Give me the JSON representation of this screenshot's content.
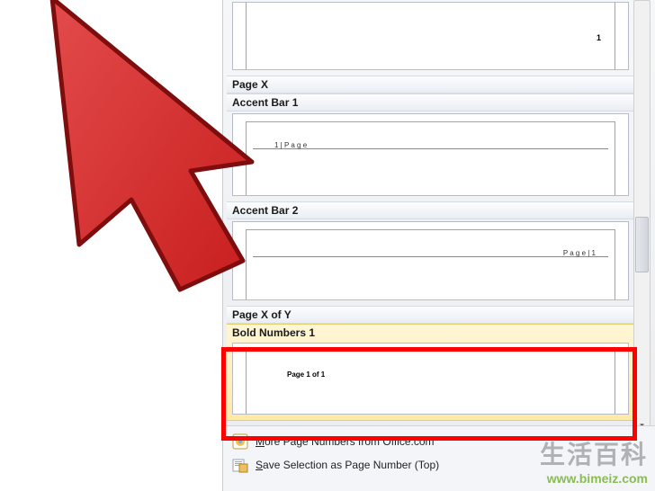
{
  "categories": {
    "page_x": "Page X",
    "accent_bar_1": "Accent Bar 1",
    "accent_bar_2": "Accent Bar 2",
    "page_x_of_y": "Page X of Y",
    "bold_numbers_1": "Bold Numbers 1"
  },
  "previews": {
    "plain3_number": "1",
    "accent1_text": "1 | P a g e",
    "accent2_text": "P a g e  | 1",
    "bold1_text": "Page 1 of 1"
  },
  "footer": {
    "more_prefix": "M",
    "more_rest": "ore Page Numbers from Office.com",
    "save_prefix": "S",
    "save_rest": "ave Selection as Page Number (Top)"
  },
  "watermark": {
    "cn": "生活百科",
    "url": "www.bimeiz.com"
  }
}
